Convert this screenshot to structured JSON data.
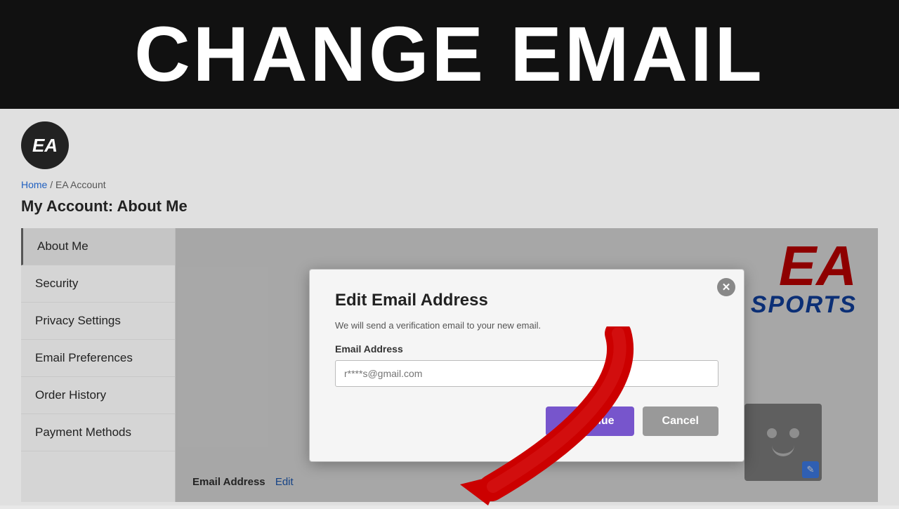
{
  "banner": {
    "title": "CHANGE EMAIL"
  },
  "breadcrumb": {
    "home": "Home",
    "separator": " / ",
    "current": "EA Account"
  },
  "page": {
    "title": "My Account: About Me"
  },
  "sidebar": {
    "items": [
      {
        "id": "about-me",
        "label": "About Me",
        "active": true
      },
      {
        "id": "security",
        "label": "Security"
      },
      {
        "id": "privacy-settings",
        "label": "Privacy Settings"
      },
      {
        "id": "email-preferences",
        "label": "Email Preferences"
      },
      {
        "id": "order-history",
        "label": "Order History"
      },
      {
        "id": "payment-methods",
        "label": "Payment Methods"
      }
    ]
  },
  "ea_logo": {
    "text": "EA"
  },
  "ea_sports": {
    "ea": "EA",
    "sports": "SPORTS"
  },
  "email_row": {
    "label": "Email Address",
    "edit_link": "Edit"
  },
  "modal": {
    "title": "Edit Email Address",
    "subtitle": "We will send a verification email to your new email.",
    "email_label": "Email Address",
    "email_placeholder": "r****s@gmail.com",
    "btn_continue": "Continue",
    "btn_cancel": "Cancel",
    "close_icon": "✕"
  }
}
